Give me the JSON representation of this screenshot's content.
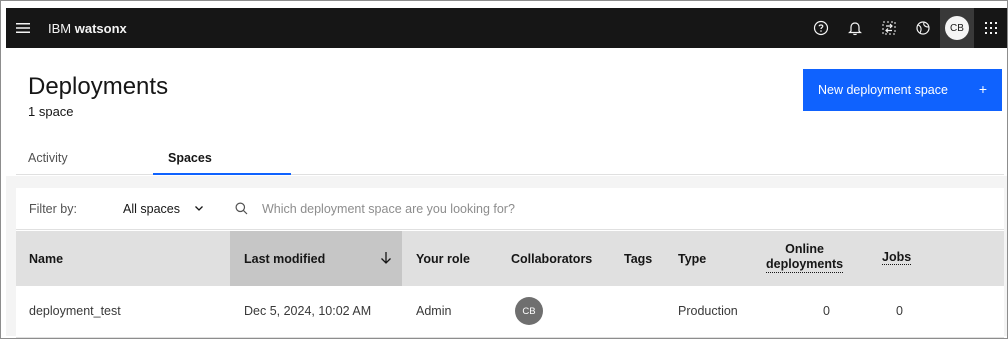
{
  "topbar": {
    "brand_prefix": "IBM",
    "brand_name": "watsonx",
    "avatar_initials": "CB",
    "icons": [
      "menu-icon",
      "help-icon",
      "notification-icon",
      "transfer-icon",
      "globe-icon",
      "avatar",
      "app-switcher-icon"
    ]
  },
  "header": {
    "title": "Deployments",
    "subtitle": "1 space",
    "new_button_label": "New deployment space",
    "new_button_icon": "+"
  },
  "tabs": [
    {
      "label": "Activity",
      "selected": false
    },
    {
      "label": "Spaces",
      "selected": true
    }
  ],
  "filter": {
    "label": "Filter by:",
    "selected": "All spaces",
    "search_placeholder": "Which deployment space are you looking for?"
  },
  "table": {
    "columns": [
      "Name",
      "Last modified",
      "Your role",
      "Collaborators",
      "Tags",
      "Type",
      "Online deployments",
      "Jobs"
    ],
    "online_line1": "Online",
    "online_line2": "deployments",
    "rows": [
      {
        "name": "deployment_test",
        "last_modified": "Dec 5, 2024, 10:02 AM",
        "role": "Admin",
        "collaborator": "CB",
        "tags": "",
        "type": "Production",
        "online": "0",
        "jobs": "0"
      }
    ]
  },
  "colors": {
    "accent": "#0f62fe",
    "topbar": "#161616",
    "sorted_header": "#c6c6c6"
  }
}
